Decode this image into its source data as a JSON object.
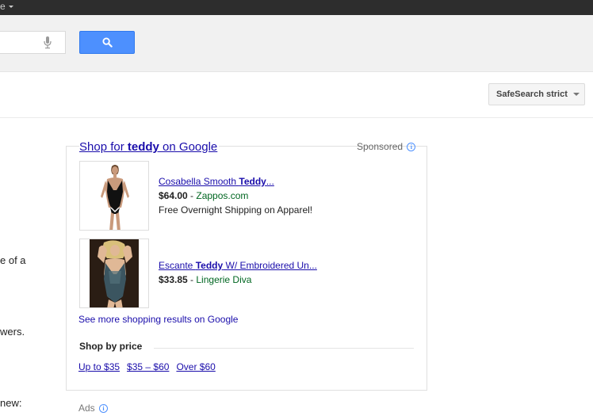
{
  "topbar": {
    "more_label": "e"
  },
  "search": {
    "value": "",
    "placeholder": ""
  },
  "tools": {
    "safesearch_label": "SafeSearch strict"
  },
  "left_fragments": [
    "e of a",
    "wers.",
    "new:"
  ],
  "shopping": {
    "title_prefix": "Shop for ",
    "title_query": "teddy",
    "title_suffix": " on Google",
    "sponsored_label": "Sponsored",
    "items": [
      {
        "title_prefix": "Cosabella Smooth ",
        "title_bold": "Teddy",
        "title_suffix": "...",
        "price": "$64.00",
        "separator": " - ",
        "seller": "Zappos.com",
        "note": "Free Overnight Shipping on Apparel!"
      },
      {
        "title_prefix": "Escante ",
        "title_bold": "Teddy",
        "title_suffix": " W/ Embroidered Un...",
        "price": "$33.85",
        "separator": " - ",
        "seller": "Lingerie Diva",
        "note": ""
      }
    ],
    "see_more": "See more shopping results on Google",
    "shop_by_price": "Shop by price",
    "price_links": [
      "Up to $35",
      "$35 – $60",
      "Over $60"
    ]
  },
  "ads_label": "Ads",
  "colors": {
    "link": "#1a0dab",
    "seller": "#006621",
    "button": "#4d90fe",
    "topbar": "#2d2d2d"
  }
}
